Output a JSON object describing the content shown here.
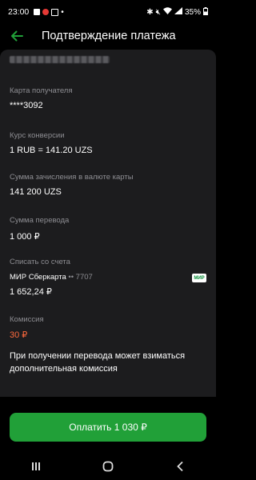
{
  "statusbar": {
    "time": "23:00",
    "battery": "35%"
  },
  "header": {
    "title": "Подтверждение платежа"
  },
  "fields": {
    "card_recipient": {
      "label": "Карта получателя",
      "value": "****3092"
    },
    "rate": {
      "label": "Курс конверсии",
      "value": "1 RUB = 141.20 UZS"
    },
    "credit_amount": {
      "label": "Сумма зачисления в валюте карты",
      "value": "141 200 UZS"
    },
    "transfer_amount": {
      "label": "Сумма перевода",
      "value": "1 000 ₽"
    },
    "debit_from": {
      "label": "Списать со счета",
      "card_name": "МИР Сберкарта",
      "card_mask": "•• 7707",
      "balance": "1 652,24 ₽",
      "badge": "МИР"
    },
    "commission": {
      "label": "Комиссия",
      "value": "30 ₽"
    }
  },
  "notice": "При получении перевода может взиматься дополнительная комиссия",
  "pay_button": {
    "label": "Оплатить 1 030 ₽"
  },
  "colors": {
    "accent": "#21a038",
    "commission": "#ff6a3d",
    "card_bg": "#1c1c1e"
  }
}
